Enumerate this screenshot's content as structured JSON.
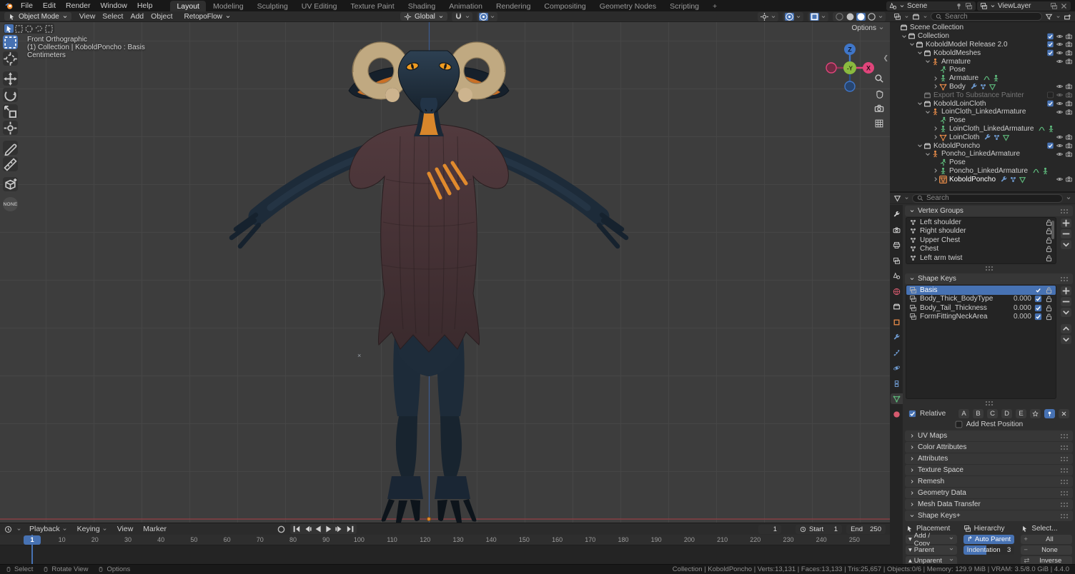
{
  "colors": {
    "accent": "#4772b3",
    "object_orange": "#e58a48",
    "data_green": "#5fbc7d",
    "icon_blue": "#6f9bd1",
    "axis_x": "#e0457b",
    "axis_z": "#3f76c9",
    "axis_y": "#8aba3f"
  },
  "topbar": {
    "menus": [
      "File",
      "Edit",
      "Render",
      "Window",
      "Help"
    ],
    "tabs": [
      "Layout",
      "Modeling",
      "Sculpting",
      "UV Editing",
      "Texture Paint",
      "Shading",
      "Animation",
      "Rendering",
      "Compositing",
      "Geometry Nodes",
      "Scripting"
    ],
    "active_tab": "Layout",
    "new_tab": "+",
    "scene_label": "Scene",
    "viewlayer_label": "ViewLayer"
  },
  "vheader": {
    "mode": "Object Mode",
    "menus": [
      "View",
      "Select",
      "Add",
      "Object"
    ],
    "addon": "RetopoFlow",
    "orientation": "Global"
  },
  "viewport": {
    "info_lines": [
      "Front Orthographic",
      "(1) Collection | KoboldPoncho : Basis",
      "Centimeters"
    ],
    "options_label": "Options",
    "gizmo": {
      "x": "X",
      "z": "Z",
      "y": "-Y"
    },
    "none_tool_label": "NONE"
  },
  "outliner": {
    "search_placeholder": "Search",
    "rows": [
      {
        "i": 0,
        "e": "",
        "ic": "coll",
        "cl": "c-wh",
        "l": "Scene Collection",
        "t": []
      },
      {
        "i": 1,
        "e": "d",
        "ic": "coll",
        "cl": "c-wh",
        "l": "Collection",
        "t": [
          "chk",
          "eye",
          "cam"
        ]
      },
      {
        "i": 2,
        "e": "d",
        "ic": "coll",
        "cl": "c-wh",
        "l": "KoboldModel Release 2.0",
        "t": [
          "chk",
          "eye",
          "cam"
        ]
      },
      {
        "i": 3,
        "e": "d",
        "ic": "coll",
        "cl": "c-wh",
        "l": "KoboldMeshes",
        "t": [
          "chk",
          "eye",
          "cam"
        ]
      },
      {
        "i": 4,
        "e": "d",
        "ic": "arm",
        "cl": "c-or",
        "l": "Armature",
        "t": [
          "",
          "eye",
          "cam"
        ]
      },
      {
        "i": 5,
        "e": "",
        "ic": "pose",
        "cl": "c-gr",
        "l": "Pose",
        "t": []
      },
      {
        "i": 5,
        "e": "r",
        "ic": "arm",
        "cl": "c-gr",
        "l": "Armature",
        "x": [
          "drv",
          "armx"
        ],
        "t": []
      },
      {
        "i": 5,
        "e": "r",
        "ic": "mesh",
        "cl": "c-or",
        "l": "Body",
        "x": [
          "wr",
          "vg",
          "meshx"
        ],
        "t": [
          "",
          "eye",
          "cam"
        ]
      },
      {
        "i": 3,
        "e": "",
        "ic": "coll",
        "cl": "c-wh",
        "l": "Export To Substance Painter",
        "gray": true,
        "t": [
          "chk0",
          "eye",
          "cam"
        ]
      },
      {
        "i": 3,
        "e": "d",
        "ic": "coll",
        "cl": "c-wh",
        "l": "KoboldLoinCloth",
        "t": [
          "chk",
          "eye",
          "cam"
        ]
      },
      {
        "i": 4,
        "e": "d",
        "ic": "arm",
        "cl": "c-or",
        "l": "LoinCloth_LinkedArmature",
        "t": [
          "",
          "eye",
          "cam"
        ]
      },
      {
        "i": 5,
        "e": "",
        "ic": "pose",
        "cl": "c-gr",
        "l": "Pose",
        "t": []
      },
      {
        "i": 5,
        "e": "r",
        "ic": "arm",
        "cl": "c-gr",
        "l": "LoinCloth_LinkedArmature",
        "x": [
          "drv",
          "armx"
        ],
        "t": []
      },
      {
        "i": 5,
        "e": "r",
        "ic": "mesh",
        "cl": "c-or",
        "l": "LoinCloth",
        "x": [
          "wr",
          "vg",
          "meshx"
        ],
        "t": [
          "",
          "eye",
          "cam"
        ]
      },
      {
        "i": 3,
        "e": "d",
        "ic": "coll",
        "cl": "c-wh",
        "l": "KoboldPoncho",
        "t": [
          "chk",
          "eye",
          "cam"
        ]
      },
      {
        "i": 4,
        "e": "d",
        "ic": "arm",
        "cl": "c-or",
        "l": "Poncho_LinkedArmature",
        "t": [
          "",
          "eye",
          "cam"
        ]
      },
      {
        "i": 5,
        "e": "",
        "ic": "pose",
        "cl": "c-gr",
        "l": "Pose",
        "t": []
      },
      {
        "i": 5,
        "e": "r",
        "ic": "arm",
        "cl": "c-gr",
        "l": "Poncho_LinkedArmature",
        "x": [
          "drv",
          "armx"
        ],
        "t": []
      },
      {
        "i": 5,
        "e": "r",
        "ic": "mesh",
        "cl": "c-or",
        "l": "KoboldPoncho",
        "sel": true,
        "x": [
          "wr",
          "vg",
          "meshx"
        ],
        "t": [
          "",
          "eye",
          "cam"
        ]
      }
    ]
  },
  "properties": {
    "search_placeholder": "Search",
    "tabs": [
      {
        "n": "tool",
        "icon": "wrench",
        "cl": "c-wh"
      },
      {
        "n": "render",
        "icon": "cam",
        "cl": "c-wh"
      },
      {
        "n": "output",
        "icon": "printer",
        "cl": "c-wh"
      },
      {
        "n": "view-layer",
        "icon": "layers",
        "cl": "c-wh"
      },
      {
        "n": "scene",
        "icon": "scene",
        "cl": "c-wh"
      },
      {
        "n": "world",
        "icon": "world",
        "cl": "c-pk"
      },
      {
        "n": "collection",
        "icon": "coll",
        "cl": "c-wh"
      },
      {
        "n": "object",
        "icon": "sq",
        "cl": "c-or"
      },
      {
        "n": "modifiers",
        "icon": "wrench",
        "cl": "c-bl"
      },
      {
        "n": "particles",
        "icon": "part",
        "cl": "c-bl"
      },
      {
        "n": "physics",
        "icon": "phys",
        "cl": "c-bl"
      },
      {
        "n": "constraints",
        "icon": "constr",
        "cl": "c-bl"
      },
      {
        "n": "data",
        "icon": "mesh",
        "cl": "c-gr",
        "active": true
      },
      {
        "n": "material",
        "icon": "sphere",
        "cl": "c-pk"
      }
    ],
    "vertex_groups": {
      "title": "Vertex Groups",
      "items": [
        "Left shoulder",
        "Right shoulder",
        "Upper Chest",
        "Chest",
        "Left arm twist"
      ]
    },
    "shape_keys": {
      "title": "Shape Keys",
      "items": [
        {
          "name": "Basis",
          "value": "",
          "selected": true
        },
        {
          "name": "Body_Thick_BodyType",
          "value": "0.000"
        },
        {
          "name": "Body_Tail_Thickness",
          "value": "0.000"
        },
        {
          "name": "FormFittingNeckArea",
          "value": "0.000"
        }
      ]
    },
    "relative_label": "Relative",
    "letters": [
      "A",
      "B",
      "C",
      "D",
      "E"
    ],
    "add_rest_label": "Add Rest Position",
    "collapsed_sections": [
      "UV Maps",
      "Color Attributes",
      "Attributes",
      "Texture Space",
      "Remesh",
      "Geometry Data",
      "Mesh Data Transfer"
    ],
    "shape_keys_plus": {
      "title": "Shape Keys+",
      "placement": {
        "title": "Placement",
        "buttons": [
          {
            "arrow": "dn",
            "label": "Add / Copy"
          },
          {
            "arrow": "dn2",
            "label": "Parent"
          },
          {
            "arrow": "up",
            "label": "Unparent"
          }
        ]
      },
      "hierarchy": {
        "title": "Hierarchy",
        "auto_parent": "Auto Parent",
        "indent_label": "Indentation",
        "indent_value": "3"
      },
      "select": {
        "title": "Select...",
        "buttons": [
          {
            "sign": "+",
            "label": "All"
          },
          {
            "sign": "−",
            "label": "None"
          },
          {
            "sign": "⇄",
            "label": "Inverse"
          }
        ]
      }
    }
  },
  "timeline": {
    "menus": [
      {
        "label": "Playback",
        "dd": true
      },
      {
        "label": "Keying",
        "dd": true
      },
      {
        "label": "View"
      },
      {
        "label": "Marker"
      }
    ],
    "current_frame": "1",
    "start_label": "Start",
    "start_value": "1",
    "end_label": "End",
    "end_value": "250",
    "ticks": [
      "10",
      "20",
      "30",
      "40",
      "50",
      "60",
      "70",
      "80",
      "90",
      "100",
      "110",
      "120",
      "130",
      "140",
      "150",
      "160",
      "170",
      "180",
      "190",
      "200",
      "210",
      "220",
      "230",
      "240",
      "250"
    ]
  },
  "statusbar": {
    "items": [
      "Select",
      "Rotate View",
      "Options"
    ],
    "stats": "Collection | KoboldPoncho | Verts:13,131 | Faces:13,133 | Tris:25,657 | Objects:0/6 | Memory: 129.9 MiB | VRAM: 3.5/8.0 GiB | 4.4.0"
  }
}
